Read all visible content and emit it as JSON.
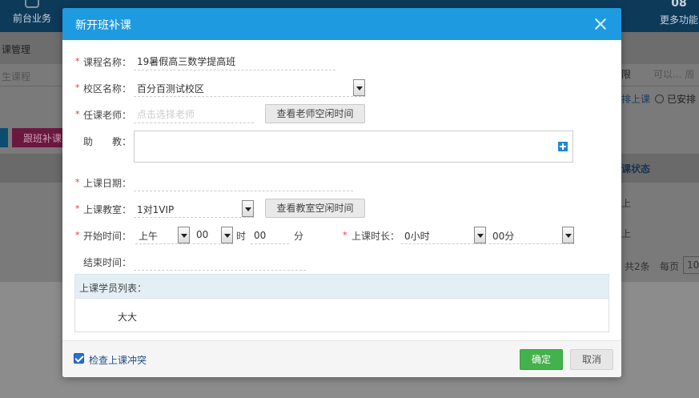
{
  "background": {
    "nav_left_label": "前台业务",
    "nav_right_count": "08",
    "nav_right_label": "更多功能",
    "breadcrumb": "课管理",
    "search_placeholder": "生课程",
    "select_left": "限",
    "select_right": "可以... 周",
    "radio_pending": "排上课",
    "radio_scheduled": "已安排",
    "btn_follow": "跟班补课",
    "col_status": "课状态",
    "cell1": "上",
    "cell2": "上",
    "total": "共2条",
    "per_page": "每页",
    "per_page_value": "10"
  },
  "modal": {
    "title": "新开班补课",
    "course_name": {
      "label": "课程名称：",
      "value": "19暑假高三数学提高班"
    },
    "campus": {
      "label": "校区名称：",
      "value": "百分百测试校区"
    },
    "teacher": {
      "label": "任课老师：",
      "placeholder": "点击选择老师",
      "button": "查看老师空闲时间"
    },
    "assistant": {
      "label": "助　　教："
    },
    "date": {
      "label": "上课日期：",
      "value": ""
    },
    "classroom": {
      "label": "上课教室：",
      "value": "1对1VIP",
      "button": "查看教室空闲时间"
    },
    "start_time": {
      "label": "开始时间：",
      "period": "上午",
      "hour": "00",
      "hour_unit": "时",
      "minute": "00",
      "minute_unit": "分"
    },
    "duration": {
      "label": "上课时长：",
      "hours": "0小时",
      "minutes": "00分"
    },
    "end_time": {
      "label": "结束时间：",
      "value": ""
    },
    "student_list": {
      "title": "上课学员列表：",
      "students": [
        "大大"
      ]
    },
    "footer": {
      "check_conflict": "检查上课冲突",
      "confirm": "确定",
      "cancel": "取消"
    }
  },
  "colors": {
    "header": "#1e9ae0",
    "confirm": "#44b24c",
    "required": "#e33333",
    "link": "#1f4e86"
  }
}
